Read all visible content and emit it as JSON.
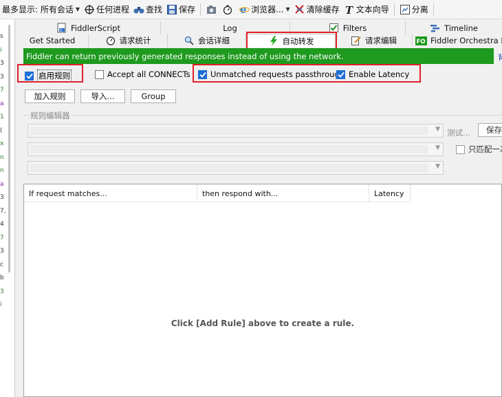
{
  "toolbar": {
    "max_display_label": "最多显示: 所有会话",
    "any_process": "任何进程",
    "find": "查找",
    "save": "保存",
    "browser": "浏览器...",
    "clear_cache": "清除缓存",
    "text_wizard": "文本向导",
    "split": "分离"
  },
  "tabs_row1": [
    {
      "label": "FiddlerScript",
      "icon": "script-icon"
    },
    {
      "label": "Log",
      "icon": ""
    },
    {
      "label": "Filters",
      "icon": "checkbox-icon"
    },
    {
      "label": "Timeline",
      "icon": "timeline-icon"
    }
  ],
  "tabs_row2": [
    {
      "label": "Get Started",
      "icon": ""
    },
    {
      "label": "请求统计",
      "icon": "timer-icon"
    },
    {
      "label": "会话详细",
      "icon": "inspect-icon"
    },
    {
      "label": "自动转发",
      "icon": "lightning-icon",
      "active": true
    },
    {
      "label": "请求编辑",
      "icon": "edit-icon"
    },
    {
      "label": "Fiddler Orchestra Be",
      "icon": "fo-icon"
    }
  ],
  "banner": {
    "text": "Fiddler can return previously generated responses instead of using the network.",
    "right_fragment": "背"
  },
  "options": {
    "enable_rules": {
      "label": "启用规则",
      "checked": true
    },
    "accept_connects": {
      "label": "Accept all CONNECTs",
      "checked": false
    },
    "unmatched_passthrough": {
      "label": "Unmatched requests passthrough",
      "checked": true
    },
    "enable_latency": {
      "label": "Enable Latency",
      "checked": true
    }
  },
  "buttons": {
    "add_rule": "加入规则",
    "import": "导入...",
    "group": "Group"
  },
  "rule_editor": {
    "legend": "规则编辑器",
    "test_label": "测试...",
    "save_label": "保存",
    "match_only_once": "只匹配一次"
  },
  "grid": {
    "columns": [
      "If request matches...",
      "then respond with...",
      "Latency"
    ],
    "empty_message": "Click [Add Rule] above to create a rule."
  },
  "left_strip_glyphs": [
    "s",
    "i",
    "3",
    "3",
    "7",
    "a",
    "1",
    "(",
    "x",
    "n",
    "n",
    "a",
    "3",
    "7,",
    "4",
    "7",
    "3",
    "c",
    "b",
    "3",
    "i"
  ],
  "colors": {
    "banner": "#1e9a1e",
    "highlight": "#e0202a",
    "checkbox": "#1f6fd6"
  }
}
